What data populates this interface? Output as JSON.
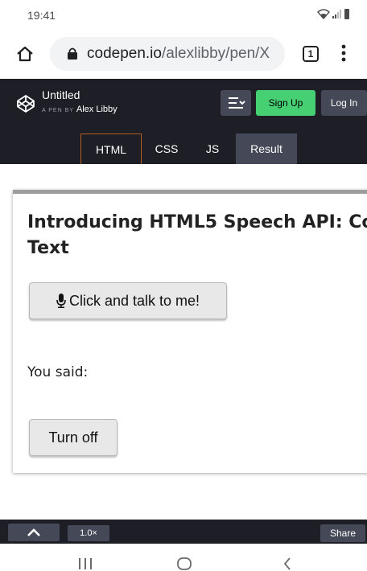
{
  "status_bar": {
    "time": "19:41"
  },
  "browser": {
    "url_domain": "codepen.io",
    "url_path": "/alexlibby/pen/X",
    "tab_count": "1"
  },
  "codepen": {
    "title": "Untitled",
    "byline_prefix": "A PEN BY",
    "author": "Alex Libby",
    "signup_label": "Sign Up",
    "login_label": "Log In",
    "tabs": [
      {
        "label": "HTML"
      },
      {
        "label": "CSS"
      },
      {
        "label": "JS"
      },
      {
        "label": "Result"
      }
    ],
    "zoom_label": "1.0×",
    "share_label": "Share"
  },
  "result": {
    "title_line1": "Introducing HTML5 Speech API: Co",
    "title_line2": "Text",
    "talk_button_label": "Click and talk to me!",
    "you_said_label": "You said:",
    "turn_off_label": "Turn off"
  },
  "colors": {
    "header_bg": "#1e1f26",
    "signup_green": "#47cf73",
    "button_gray": "#444857",
    "html_tab_border": "#b35e1c"
  }
}
